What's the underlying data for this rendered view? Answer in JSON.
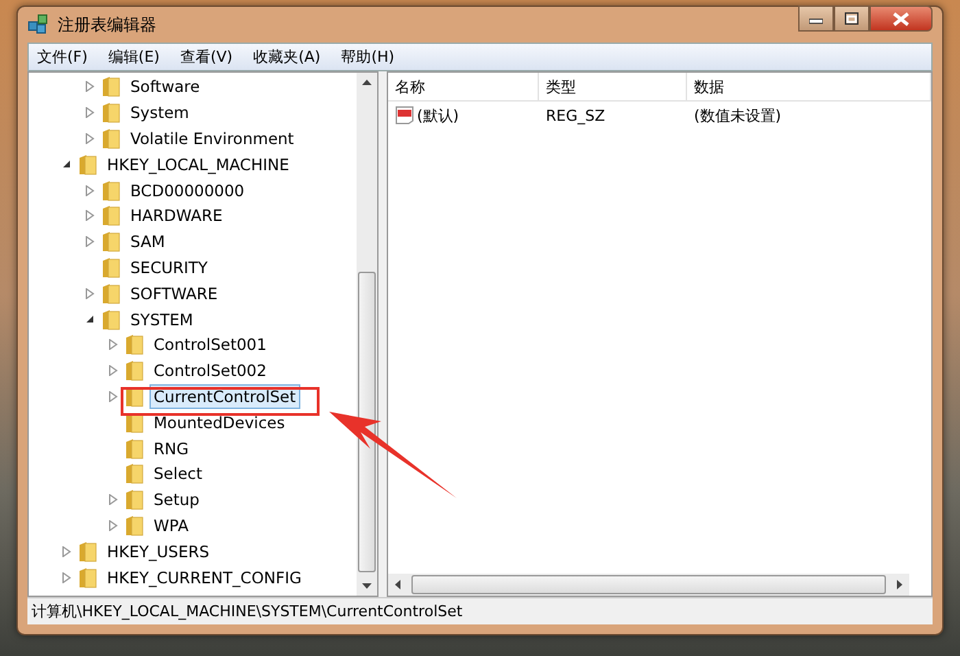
{
  "window": {
    "title": "注册表编辑器"
  },
  "menu": [
    "文件(F)",
    "编辑(E)",
    "查看(V)",
    "收藏夹(A)",
    "帮助(H)"
  ],
  "tree": [
    {
      "children": [
        {
          "label": "Software",
          "expandable": true,
          "expanded": false,
          "selected": false
        },
        {
          "label": "System",
          "expandable": true,
          "expanded": false,
          "selected": false
        },
        {
          "label": "Volatile Environment",
          "expandable": true,
          "expanded": false,
          "selected": false
        }
      ]
    },
    {
      "label": "HKEY_LOCAL_MACHINE",
      "expandable": true,
      "expanded": true,
      "selected": false,
      "children": [
        {
          "label": "BCD00000000",
          "expandable": true,
          "expanded": false,
          "selected": false
        },
        {
          "label": "HARDWARE",
          "expandable": true,
          "expanded": false,
          "selected": false
        },
        {
          "label": "SAM",
          "expandable": true,
          "expanded": false,
          "selected": false
        },
        {
          "label": "SECURITY",
          "selected": false
        },
        {
          "label": "SOFTWARE",
          "expandable": true,
          "expanded": false,
          "selected": false
        },
        {
          "label": "SYSTEM",
          "expandable": true,
          "expanded": true,
          "selected": false,
          "children": [
            {
              "label": "ControlSet001",
              "expandable": true,
              "expanded": false,
              "selected": false
            },
            {
              "label": "ControlSet002",
              "expandable": true,
              "expanded": false,
              "selected": false
            },
            {
              "label": "CurrentControlSet",
              "expandable": true,
              "expanded": false,
              "selected": true
            },
            {
              "label": "MountedDevices",
              "selected": false
            },
            {
              "label": "RNG",
              "selected": false
            },
            {
              "label": "Select",
              "selected": false
            },
            {
              "label": "Setup",
              "expandable": true,
              "expanded": false,
              "selected": false
            },
            {
              "label": "WPA",
              "expandable": true,
              "expanded": false,
              "selected": false
            }
          ]
        }
      ]
    },
    {
      "label": "HKEY_USERS",
      "expandable": true,
      "expanded": false,
      "selected": false
    },
    {
      "label": "HKEY_CURRENT_CONFIG",
      "expandable": true,
      "expanded": false,
      "selected": false
    }
  ],
  "table": {
    "columns": [
      "名称",
      "类型",
      "数据"
    ],
    "rows": [
      {
        "name": "(默认)",
        "type": "REG_SZ",
        "data": "(数值未设置)"
      }
    ]
  },
  "status_bar": "计算机\\HKEY_LOCAL_MACHINE\\SYSTEM\\CurrentControlSet"
}
